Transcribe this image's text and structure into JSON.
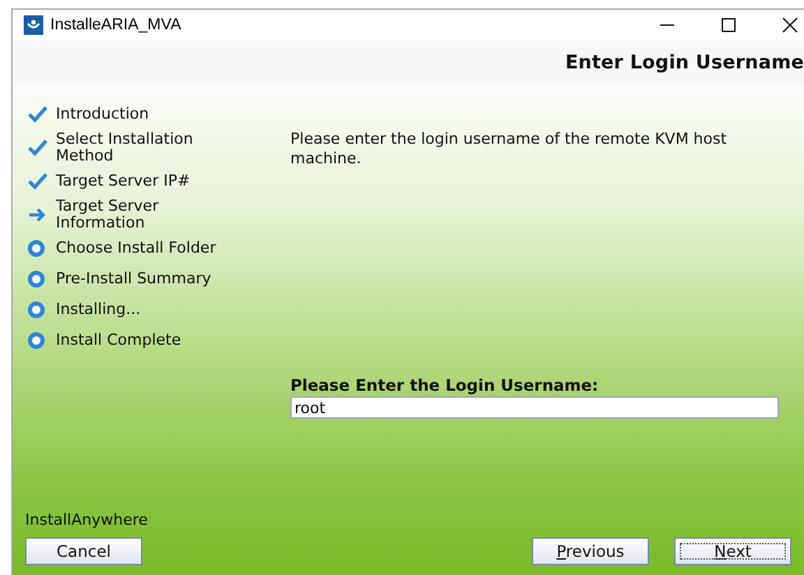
{
  "window": {
    "title": "InstalleARIA_MVA"
  },
  "header": {
    "title": "Enter Login Username"
  },
  "steps": [
    {
      "label": "Introduction",
      "kind": "done"
    },
    {
      "label": "Select Installation Method",
      "kind": "done"
    },
    {
      "label": "Target Server IP#",
      "kind": "done"
    },
    {
      "label": "Target Server Information",
      "kind": "current"
    },
    {
      "label": "Choose Install Folder",
      "kind": "pending"
    },
    {
      "label": "Pre-Install Summary",
      "kind": "pending"
    },
    {
      "label": "Installing...",
      "kind": "pending"
    },
    {
      "label": "Install Complete",
      "kind": "pending"
    }
  ],
  "instructions": "Please enter the login username of the remote KVM host machine.",
  "field": {
    "label": "Please Enter the Login Username:",
    "value": "root"
  },
  "brand": "InstallAnywhere",
  "buttons": {
    "cancel": {
      "label": "Cancel",
      "mnemonic": false
    },
    "previous": {
      "label": "Previous",
      "mnemonic": true
    },
    "next": {
      "label": "Next",
      "mnemonic": true,
      "focused": true
    }
  }
}
